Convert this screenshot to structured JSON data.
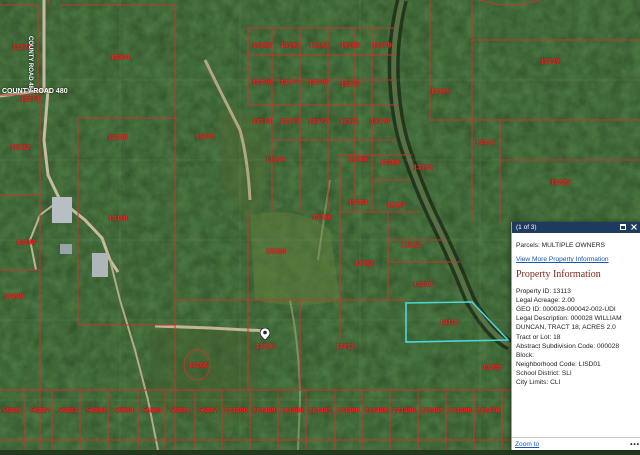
{
  "map": {
    "road_label": "COUNTY ROAD 480",
    "road_label_vertical": "COUNTY ROAD 484",
    "parcel_labels": [
      "13273",
      "13004",
      "13274",
      "13236",
      "13231",
      "13132",
      "13116",
      "13248",
      "13249",
      "13183",
      "13181",
      "13182",
      "13180",
      "13179",
      "13178",
      "13177",
      "13176",
      "13175",
      "13174",
      "13173",
      "13172",
      "13171",
      "13170",
      "13169",
      "13168",
      "13166",
      "13165",
      "13164",
      "13167",
      "13180",
      "13204",
      "13162",
      "13163",
      "13238",
      "13219",
      "13161",
      "13313",
      "13225",
      "13212",
      "13160",
      "13208",
      "13205",
      "13113",
      "13151",
      "13262",
      "13244",
      "13220",
      "13096",
      "13191",
      "13185",
      "13175",
      "13188",
      "13199",
      "13115",
      "13116",
      "13197",
      "13113",
      "13113",
      "13150",
      "13114"
    ],
    "bottom_labels": [
      "56881",
      "56887",
      "56883",
      "56890",
      "56884",
      "56889",
      "56891",
      "56887",
      "221400",
      "221489",
      "221480",
      "221481",
      "221400",
      "221489",
      "221490",
      "221491",
      "221400",
      "221478"
    ],
    "highlight_label": "13113",
    "marker_icon": "map-pin-icon"
  },
  "popup": {
    "counter": "(1 of 3)",
    "parcels": "Parcels: MULTIPLE OWNERS",
    "link": "View More Property Information",
    "section_title": "Property Information",
    "fields": [
      {
        "label": "Property ID:",
        "value": "13113"
      },
      {
        "label": "Legal Acreage:",
        "value": "2.00"
      },
      {
        "label": "GEO ID:",
        "value": "000028-000042-002-UDI"
      },
      {
        "label": "Legal Description:",
        "value": "000028 WILLIAM DUNCAN, TRACT 18, ACRES 2.0"
      },
      {
        "label": "Tract or Lot:",
        "value": "18"
      },
      {
        "label": "Abstract Subdivision Code:",
        "value": "000028"
      },
      {
        "label": "Block:",
        "value": ""
      },
      {
        "label": "Neighborhood Code:",
        "value": "LISD01"
      },
      {
        "label": "School District:",
        "value": "SLI"
      },
      {
        "label": "City Limits:",
        "value": "CLI"
      }
    ],
    "zoom_label": "Zoom to",
    "more_label": "•••",
    "icons": {
      "maximize": "maximize-icon",
      "close": "close-icon"
    }
  },
  "colors": {
    "parcel_line": "#c0392b",
    "label": "#ff2a2a",
    "highlight": "#4dd8d8",
    "popup_header": "#1f3a5f",
    "link": "#1a55b5"
  }
}
